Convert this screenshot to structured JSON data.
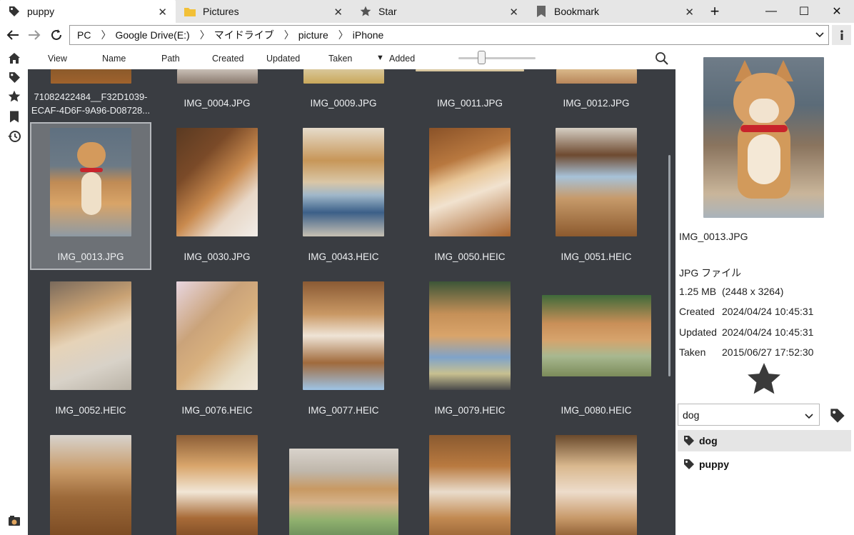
{
  "tabs": [
    {
      "label": "puppy",
      "icon": "tag-icon",
      "active": true
    },
    {
      "label": "Pictures",
      "icon": "folder-icon",
      "active": false
    },
    {
      "label": "Star",
      "icon": "star-icon",
      "active": false
    },
    {
      "label": "Bookmark",
      "icon": "bookmark-icon",
      "active": false
    }
  ],
  "tab_close": "✕",
  "new_tab": "+",
  "window": {
    "minimize": "—",
    "maximize": "☐",
    "close": "✕"
  },
  "breadcrumb": [
    "PC",
    "Google Drive(E:)",
    "マイドライブ",
    "picture",
    "iPhone"
  ],
  "breadcrumb_sep": "〉",
  "sort": {
    "view": "View",
    "name": "Name",
    "path": "Path",
    "created": "Created",
    "updated": "Updated",
    "taken": "Taken",
    "added": "Added",
    "added_indicator": "▼",
    "zoom_fraction": 0.28
  },
  "grid": {
    "row0": [
      "71082422484__F32D1039-ECAF-4D6F-9A96-D08728...",
      "IMG_0004.JPG",
      "IMG_0009.JPG",
      "IMG_0011.JPG",
      "IMG_0012.JPG"
    ],
    "row1": [
      "IMG_0013.JPG",
      "IMG_0030.JPG",
      "IMG_0043.HEIC",
      "IMG_0050.HEIC",
      "IMG_0051.HEIC"
    ],
    "row2": [
      "IMG_0052.HEIC",
      "IMG_0076.HEIC",
      "IMG_0077.HEIC",
      "IMG_0079.HEIC",
      "IMG_0080.HEIC"
    ],
    "selected": "IMG_0013.JPG"
  },
  "details": {
    "filename": "IMG_0013.JPG",
    "filetype": "JPG ファイル",
    "size": "1.25 MB",
    "dimensions": "(2448 x 3264)",
    "created_label": "Created",
    "created": "2024/04/24 10:45:31",
    "updated_label": "Updated",
    "updated": "2024/04/24 10:45:31",
    "taken_label": "Taken",
    "taken": "2015/06/27 17:52:30"
  },
  "tag_input": "dog",
  "tags": [
    "dog",
    "puppy"
  ],
  "colors": {
    "grid_bg": "#3a3d42",
    "selection": "#6d7176",
    "tab_bar": "#e6e6e6",
    "collar": "#c8232b"
  }
}
